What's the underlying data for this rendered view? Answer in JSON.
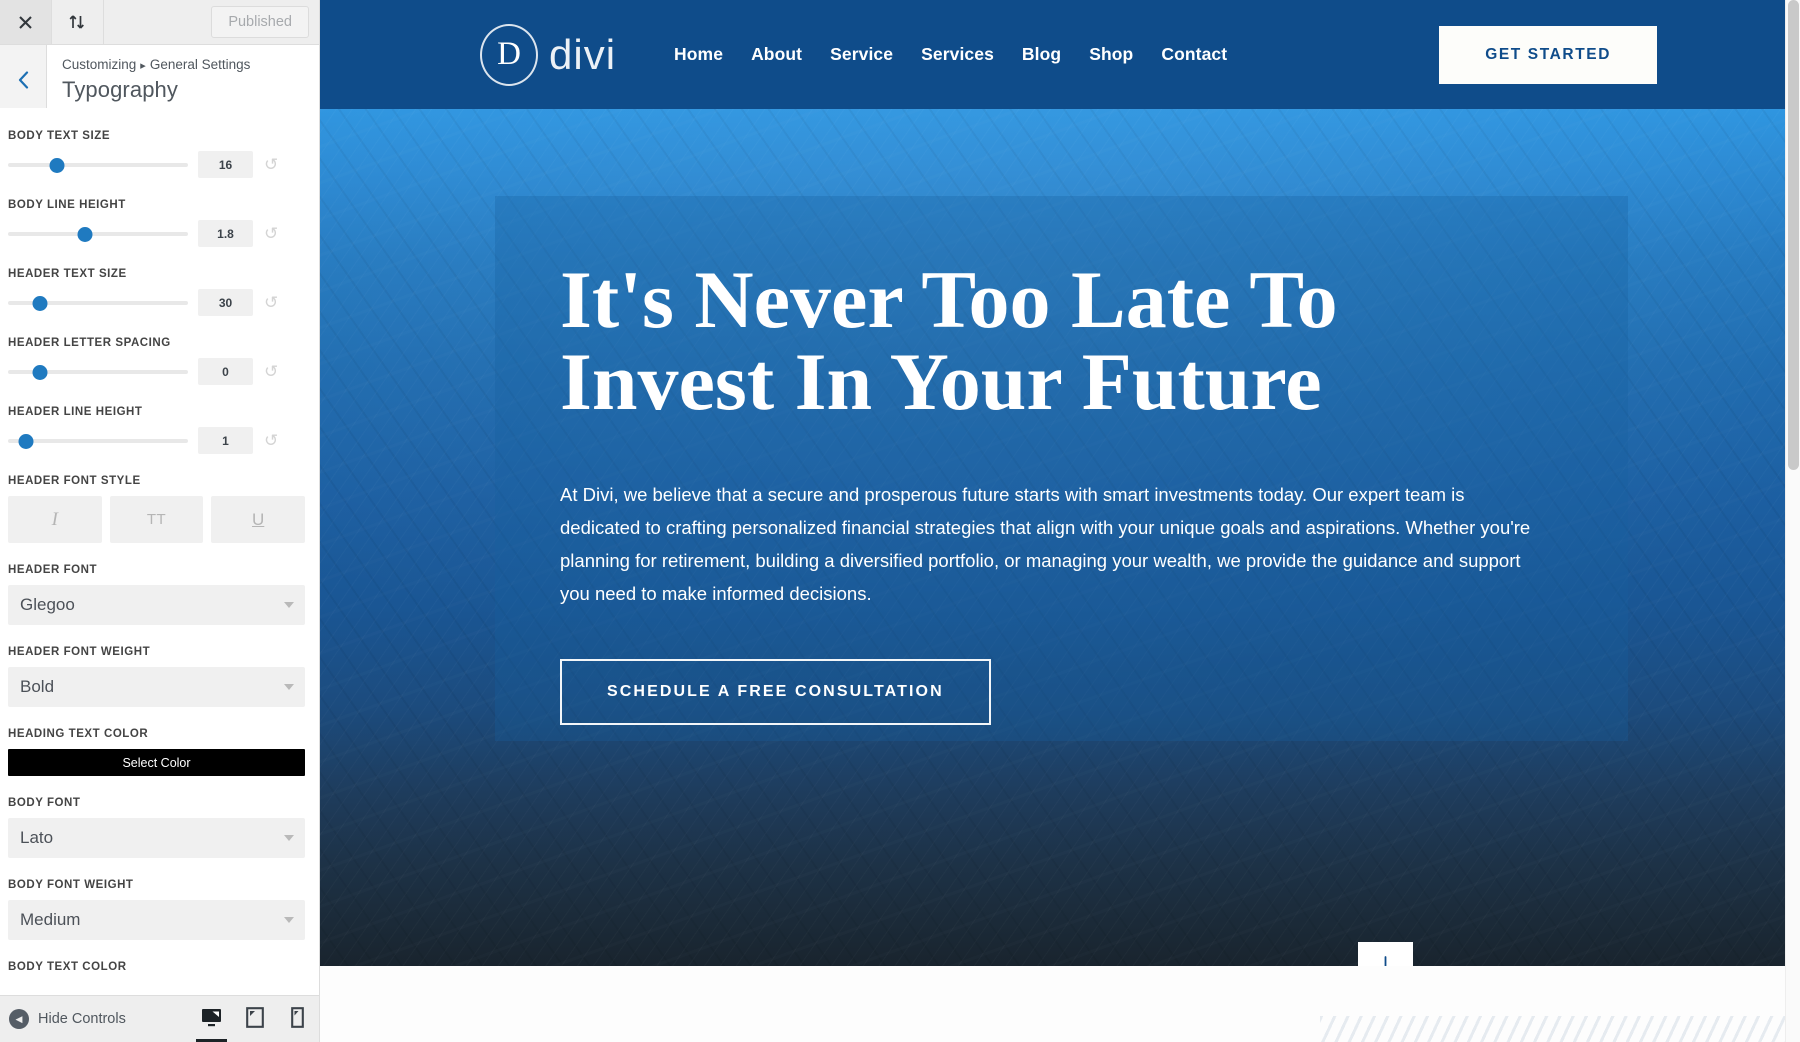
{
  "customizer": {
    "topbar": {
      "close_icon": "close-icon",
      "devices_toggle_icon": "sync-arrows-icon",
      "status_label": "Published"
    },
    "header": {
      "back_icon": "chevron-left-icon",
      "breadcrumb_root": "Customizing",
      "breadcrumb_separator": "▸",
      "breadcrumb_section": "General Settings",
      "panel_title": "Typography"
    },
    "controls": [
      {
        "type": "slider",
        "name": "body-text-size",
        "label": "BODY TEXT SIZE",
        "value": "16",
        "percent": 27,
        "reset_icon": "reset-icon"
      },
      {
        "type": "slider",
        "name": "body-line-height",
        "label": "BODY LINE HEIGHT",
        "value": "1.8",
        "percent": 43,
        "reset_icon": "reset-icon"
      },
      {
        "type": "slider",
        "name": "header-text-size",
        "label": "HEADER TEXT SIZE",
        "value": "30",
        "percent": 18,
        "reset_icon": "reset-icon"
      },
      {
        "type": "slider",
        "name": "header-letter-spacing",
        "label": "HEADER LETTER SPACING",
        "value": "0",
        "percent": 18,
        "reset_icon": "reset-icon"
      },
      {
        "type": "slider",
        "name": "header-line-height",
        "label": "HEADER LINE HEIGHT",
        "value": "1",
        "percent": 10,
        "reset_icon": "reset-icon"
      }
    ],
    "font_style": {
      "label": "HEADER FONT STYLE",
      "buttons": [
        {
          "name": "italic-button",
          "glyph": "I",
          "icon": "italic-icon"
        },
        {
          "name": "uppercase-button",
          "glyph": "TT",
          "icon": "uppercase-icon"
        },
        {
          "name": "underline-button",
          "glyph": "U",
          "icon": "underline-icon"
        }
      ]
    },
    "header_font": {
      "label": "HEADER FONT",
      "value": "Glegoo"
    },
    "header_font_weight": {
      "label": "HEADER FONT WEIGHT",
      "value": "Bold"
    },
    "heading_text_color": {
      "label": "HEADING TEXT COLOR",
      "button_label": "Select Color",
      "swatch": "#000000"
    },
    "body_font": {
      "label": "BODY FONT",
      "value": "Lato"
    },
    "body_font_weight": {
      "label": "BODY FONT WEIGHT",
      "value": "Medium"
    },
    "body_text_color": {
      "label": "BODY TEXT COLOR"
    },
    "footer": {
      "hide_controls_label": "Hide Controls",
      "hide_controls_icon": "collapse-left-icon",
      "devices": [
        {
          "name": "device-desktop",
          "icon": "desktop-icon",
          "active": true
        },
        {
          "name": "device-tablet",
          "icon": "tablet-icon",
          "active": false
        },
        {
          "name": "device-mobile",
          "icon": "mobile-icon",
          "active": false
        }
      ]
    }
  },
  "preview": {
    "nav": {
      "logo_letter": "D",
      "logo_word": "divi",
      "links": [
        "Home",
        "About",
        "Service",
        "Services",
        "Blog",
        "Shop",
        "Contact"
      ],
      "cta_label": "GET STARTED"
    },
    "hero": {
      "title": "It's Never Too Late To\nInvest In Your Future",
      "paragraph": "At Divi, we believe that a secure and prosperous future starts with smart investments today. Our expert team is dedicated to crafting personalized financial strategies that align with your unique goals and aspirations. Whether you're planning for retirement, building a diversified portfolio, or managing your wealth, we provide the guidance and support you need to make informed decisions.",
      "cta_label": "SCHEDULE A FREE CONSULTATION",
      "scroll_icon": "arrow-down-icon"
    }
  },
  "colors": {
    "nav_blue": "#0f4c8a",
    "accent_blue": "#1f7ac0",
    "hero_top": "#2e95e0",
    "cta_bg": "#fdfdfa"
  }
}
